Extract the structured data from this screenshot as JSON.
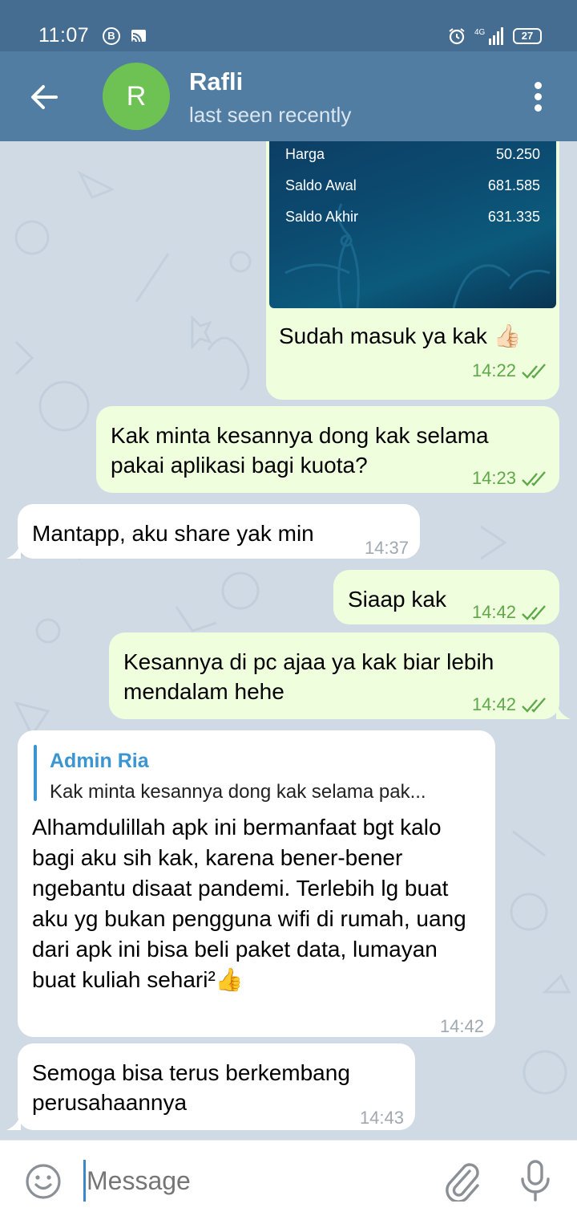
{
  "status_bar": {
    "time": "11:07",
    "b_badge": "B",
    "battery": "27"
  },
  "header": {
    "avatar_letter": "R",
    "name": "Rafli",
    "status": "last seen recently"
  },
  "photo": {
    "rows": [
      {
        "label": "Harga",
        "value": "50.250"
      },
      {
        "label": "Saldo Awal",
        "value": "681.585"
      },
      {
        "label": "Saldo Akhir",
        "value": "631.335"
      }
    ]
  },
  "messages": [
    {
      "text": "Sudah masuk ya kak 👍🏻",
      "time": "14:22"
    },
    {
      "text": "Kak minta kesannya dong kak selama pakai aplikasi bagi kuota?",
      "time": "14:23"
    },
    {
      "text": "Mantapp, aku share yak min",
      "time": "14:37"
    },
    {
      "text": "Siaap kak",
      "time": "14:42"
    },
    {
      "text": "Kesannya di pc ajaa ya kak biar lebih mendalam hehe",
      "time": "14:42"
    },
    {
      "reply_name": "Admin Ria",
      "reply_text": "Kak minta kesannya dong kak selama pak...",
      "text": "Alhamdulillah apk ini bermanfaat bgt kalo bagi aku sih kak, karena bener-bener ngebantu disaat pandemi. Terlebih lg buat aku yg bukan pengguna wifi di rumah, uang dari apk ini bisa beli paket data, lumayan buat kuliah sehari²👍",
      "time": "14:42"
    },
    {
      "text": "Semoga bisa terus berkembang perusahaannya",
      "time": "14:43"
    }
  ],
  "composer": {
    "placeholder": "Message"
  },
  "colors": {
    "header": "#517da2",
    "status_bar": "#456d91",
    "outgoing": "#effedd",
    "incoming": "#ffffff",
    "accent": "#3a95d0"
  }
}
